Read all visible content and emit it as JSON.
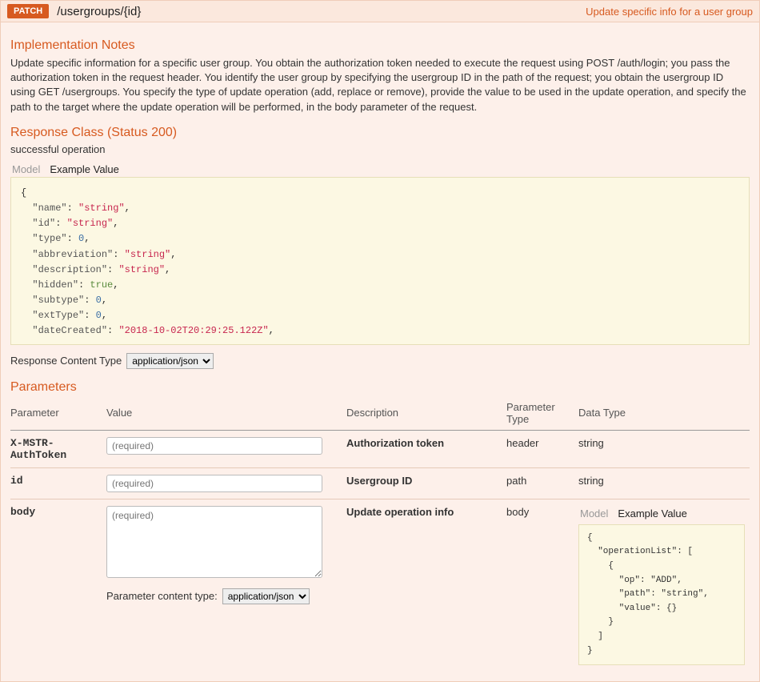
{
  "header": {
    "method": "PATCH",
    "path": "/usergroups/{id}",
    "summary": "Update specific info for a user group"
  },
  "impl": {
    "title": "Implementation Notes",
    "text": "Update specific information for a specific user group. You obtain the authorization token needed to execute the request using POST /auth/login; you pass the authorization token in the request header. You identify the user group by specifying the usergroup ID in the path of the request; you obtain the usergroup ID using GET /usergroups. You specify the type of update operation (add, replace or remove), provide the value to be used in the update operation, and specify the path to the target where the update operation will be performed, in the body parameter of the request."
  },
  "response": {
    "title": "Response Class (Status 200)",
    "statusText": "successful operation",
    "tabs": {
      "model": "Model",
      "example": "Example Value"
    },
    "exampleLines": [
      {
        "indent": 0,
        "text": "{"
      },
      {
        "indent": 2,
        "key": "\"name\"",
        "sep": ": ",
        "val": "\"string\"",
        "cls": "str",
        "comma": true
      },
      {
        "indent": 2,
        "key": "\"id\"",
        "sep": ": ",
        "val": "\"string\"",
        "cls": "str",
        "comma": true
      },
      {
        "indent": 2,
        "key": "\"type\"",
        "sep": ": ",
        "val": "0",
        "cls": "num",
        "comma": true
      },
      {
        "indent": 2,
        "key": "\"abbreviation\"",
        "sep": ": ",
        "val": "\"string\"",
        "cls": "str",
        "comma": true
      },
      {
        "indent": 2,
        "key": "\"description\"",
        "sep": ": ",
        "val": "\"string\"",
        "cls": "str",
        "comma": true
      },
      {
        "indent": 2,
        "key": "\"hidden\"",
        "sep": ": ",
        "val": "true",
        "cls": "bool",
        "comma": true
      },
      {
        "indent": 2,
        "key": "\"subtype\"",
        "sep": ": ",
        "val": "0",
        "cls": "num",
        "comma": true
      },
      {
        "indent": 2,
        "key": "\"extType\"",
        "sep": ": ",
        "val": "0",
        "cls": "num",
        "comma": true
      },
      {
        "indent": 2,
        "key": "\"dateCreated\"",
        "sep": ": ",
        "val": "\"2018-10-02T20:29:25.122Z\"",
        "cls": "str",
        "comma": true
      }
    ]
  },
  "responseContentType": {
    "label": "Response Content Type",
    "options": [
      "application/json"
    ]
  },
  "parameters": {
    "title": "Parameters",
    "headers": {
      "param": "Parameter",
      "value": "Value",
      "desc": "Description",
      "ptype": "Parameter Type",
      "dtype": "Data Type"
    },
    "rows": [
      {
        "name": "X-MSTR-AuthToken",
        "placeholder": "(required)",
        "desc": "Authorization token",
        "ptype": "header",
        "dtype": "string",
        "input": "text"
      },
      {
        "name": "id",
        "placeholder": "(required)",
        "desc": "Usergroup ID",
        "ptype": "path",
        "dtype": "string",
        "input": "text"
      },
      {
        "name": "body",
        "placeholder": "(required)",
        "desc": "Update operation info",
        "ptype": "body",
        "input": "textarea"
      }
    ],
    "paramContentType": {
      "label": "Parameter content type:",
      "options": [
        "application/json"
      ]
    },
    "bodySchema": {
      "tabs": {
        "model": "Model",
        "example": "Example Value"
      },
      "lines": [
        {
          "indent": 0,
          "text": "{"
        },
        {
          "indent": 2,
          "key": "\"operationList\"",
          "sep": ": ",
          "text": "["
        },
        {
          "indent": 4,
          "text": "{"
        },
        {
          "indent": 6,
          "key": "\"op\"",
          "sep": ": ",
          "val": "\"ADD\"",
          "cls": "str",
          "comma": true
        },
        {
          "indent": 6,
          "key": "\"path\"",
          "sep": ": ",
          "val": "\"string\"",
          "cls": "str",
          "comma": true
        },
        {
          "indent": 6,
          "key": "\"value\"",
          "sep": ": ",
          "text": "{}"
        },
        {
          "indent": 4,
          "text": "}"
        },
        {
          "indent": 2,
          "text": "]"
        },
        {
          "indent": 0,
          "text": "}"
        }
      ]
    }
  }
}
